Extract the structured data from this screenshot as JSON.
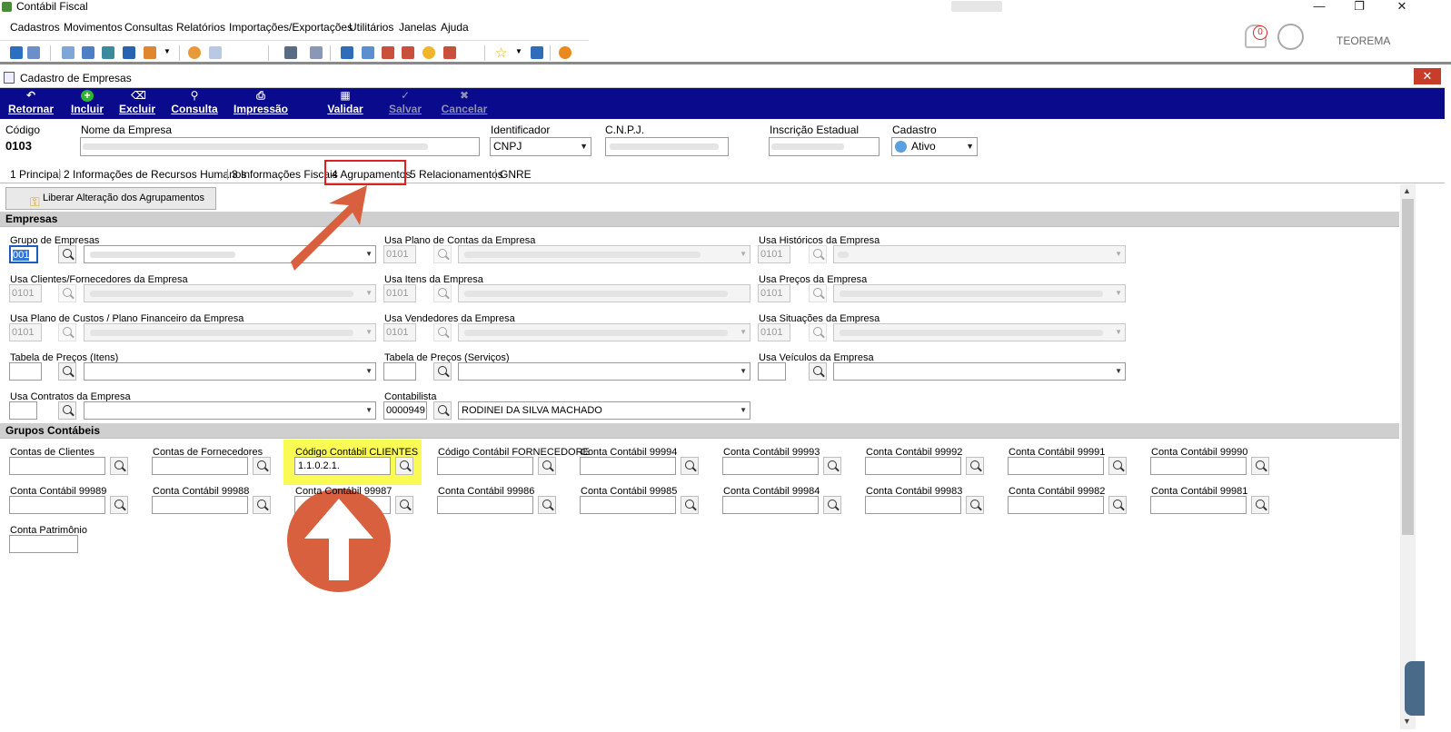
{
  "app": {
    "title": "Contábil Fiscal",
    "user": "TEOREMA",
    "notifications": "0"
  },
  "menu": [
    "Cadastros",
    "Movimentos",
    "Consultas",
    "Relatórios",
    "Importações/Exportações",
    "Utilitários",
    "Janelas",
    "Ajuda"
  ],
  "window": {
    "title": "Cadastro de Empresas",
    "close": "✕"
  },
  "actions": {
    "retornar": "Retornar",
    "incluir": "Incluir",
    "excluir": "Excluir",
    "consulta": "Consulta",
    "impressao": "Impressão",
    "validar": "Validar",
    "salvar": "Salvar",
    "cancelar": "Cancelar"
  },
  "header": {
    "codigo_label": "Código",
    "codigo": "0103",
    "nome_label": "Nome da Empresa",
    "identificador_label": "Identificador",
    "identificador": "CNPJ",
    "cnpj_label": "C.N.P.J.",
    "ie_label": "Inscrição Estadual",
    "cadastro_label": "Cadastro",
    "cadastro": "Ativo"
  },
  "tabs": [
    "1 Principal",
    "2 Informações de Recursos Humanos",
    "3 Informações Fiscais",
    "4 Agrupamentos",
    "5 Relacionamentos",
    "GNRE"
  ],
  "liberar_button": "Liberar Alteração dos Agrupamentos",
  "sections": {
    "empresas": "Empresas",
    "grupos": "Grupos Contábeis"
  },
  "empresas": {
    "grupo": {
      "label": "Grupo de Empresas",
      "code": "001"
    },
    "plano_contas": {
      "label": "Usa Plano de Contas da Empresa",
      "code": "0101"
    },
    "historicos": {
      "label": "Usa Históricos da Empresa",
      "code": "0101"
    },
    "clientes": {
      "label": "Usa Clientes/Fornecedores da Empresa",
      "code": "0101"
    },
    "itens": {
      "label": "Usa Itens da Empresa",
      "code": "0101"
    },
    "precos": {
      "label": "Usa Preços da Empresa",
      "code": "0101"
    },
    "custos": {
      "label": "Usa Plano de Custos / Plano Financeiro da Empresa",
      "code": "0101"
    },
    "vendedores": {
      "label": "Usa Vendedores da Empresa",
      "code": "0101"
    },
    "situacoes": {
      "label": "Usa Situações da Empresa",
      "code": "0101"
    },
    "tabela_itens": {
      "label": "Tabela de Preços (Itens)"
    },
    "tabela_servicos": {
      "label": "Tabela de Preços (Serviços)"
    },
    "veiculos": {
      "label": "Usa Veículos da Empresa"
    },
    "contratos": {
      "label": "Usa Contratos da Empresa"
    },
    "contabilista": {
      "label": "Contabilista",
      "code": "0000949",
      "name": "RODINEI DA SILVA MACHADO"
    }
  },
  "grupos": {
    "row1": [
      "Contas de Clientes",
      "Contas de Fornecedores",
      "Código Contábil CLIENTES",
      "Código Contábil FORNECEDORE",
      "Conta Contábil 99994",
      "Conta Contábil 99993",
      "Conta Contábil 99992",
      "Conta Contábil 99991",
      "Conta Contábil 99990"
    ],
    "row2": [
      "Conta Contábil 99989",
      "Conta Contábil 99988",
      "Conta Contábil 99987",
      "Conta Contábil 99986",
      "Conta Contábil 99985",
      "Conta Contábil 99984",
      "Conta Contábil 99983",
      "Conta Contábil 99982",
      "Conta Contábil 99981"
    ],
    "clientes_value": "1.1.0.2.1.",
    "patrimonio": "Conta Patrimônio"
  },
  "colors": {
    "actionbar": "#0a0a8c",
    "highlight": "#fafa55",
    "arrow": "#d9603e",
    "tab_outline": "#e02020"
  }
}
